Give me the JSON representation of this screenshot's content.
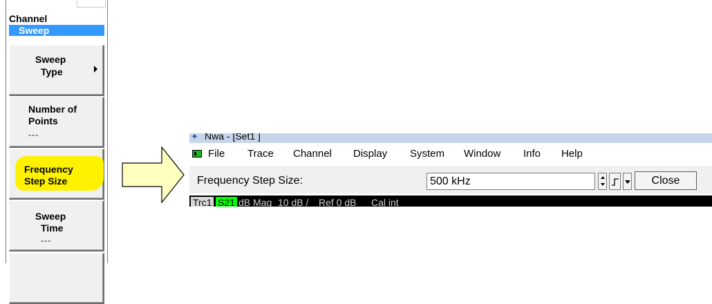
{
  "softkey_panel": {
    "title": "Channel",
    "subtitle": "Sweep",
    "keys": [
      {
        "line1": "Sweep",
        "line2": "Type",
        "sub": ""
      },
      {
        "line1": "Number of",
        "line2": "Points",
        "sub": "---"
      },
      {
        "line1": "Frequency",
        "line2": "Step Size",
        "sub": ""
      },
      {
        "line1": "Sweep",
        "line2": "Time",
        "sub": "---"
      }
    ],
    "highlight_color": "#fff200"
  },
  "arrow": {
    "fill": "#ffffc0",
    "stroke": "#000000"
  },
  "window": {
    "title": "Nwa - [Set1 ]",
    "menu": [
      "File",
      "Trace",
      "Channel",
      "Display",
      "System",
      "Window",
      "Info",
      "Help"
    ]
  },
  "step_dialog": {
    "label": "Frequency Step Size:",
    "value": "500 kHz",
    "close_label": "Close"
  },
  "trace_bar": {
    "trace": "Trc1",
    "param": "S21",
    "format": "dB Mag",
    "scale": "10 dB /",
    "ref": "Ref 0 dB",
    "cal": "Cal int",
    "param_color": "#00ff00"
  }
}
